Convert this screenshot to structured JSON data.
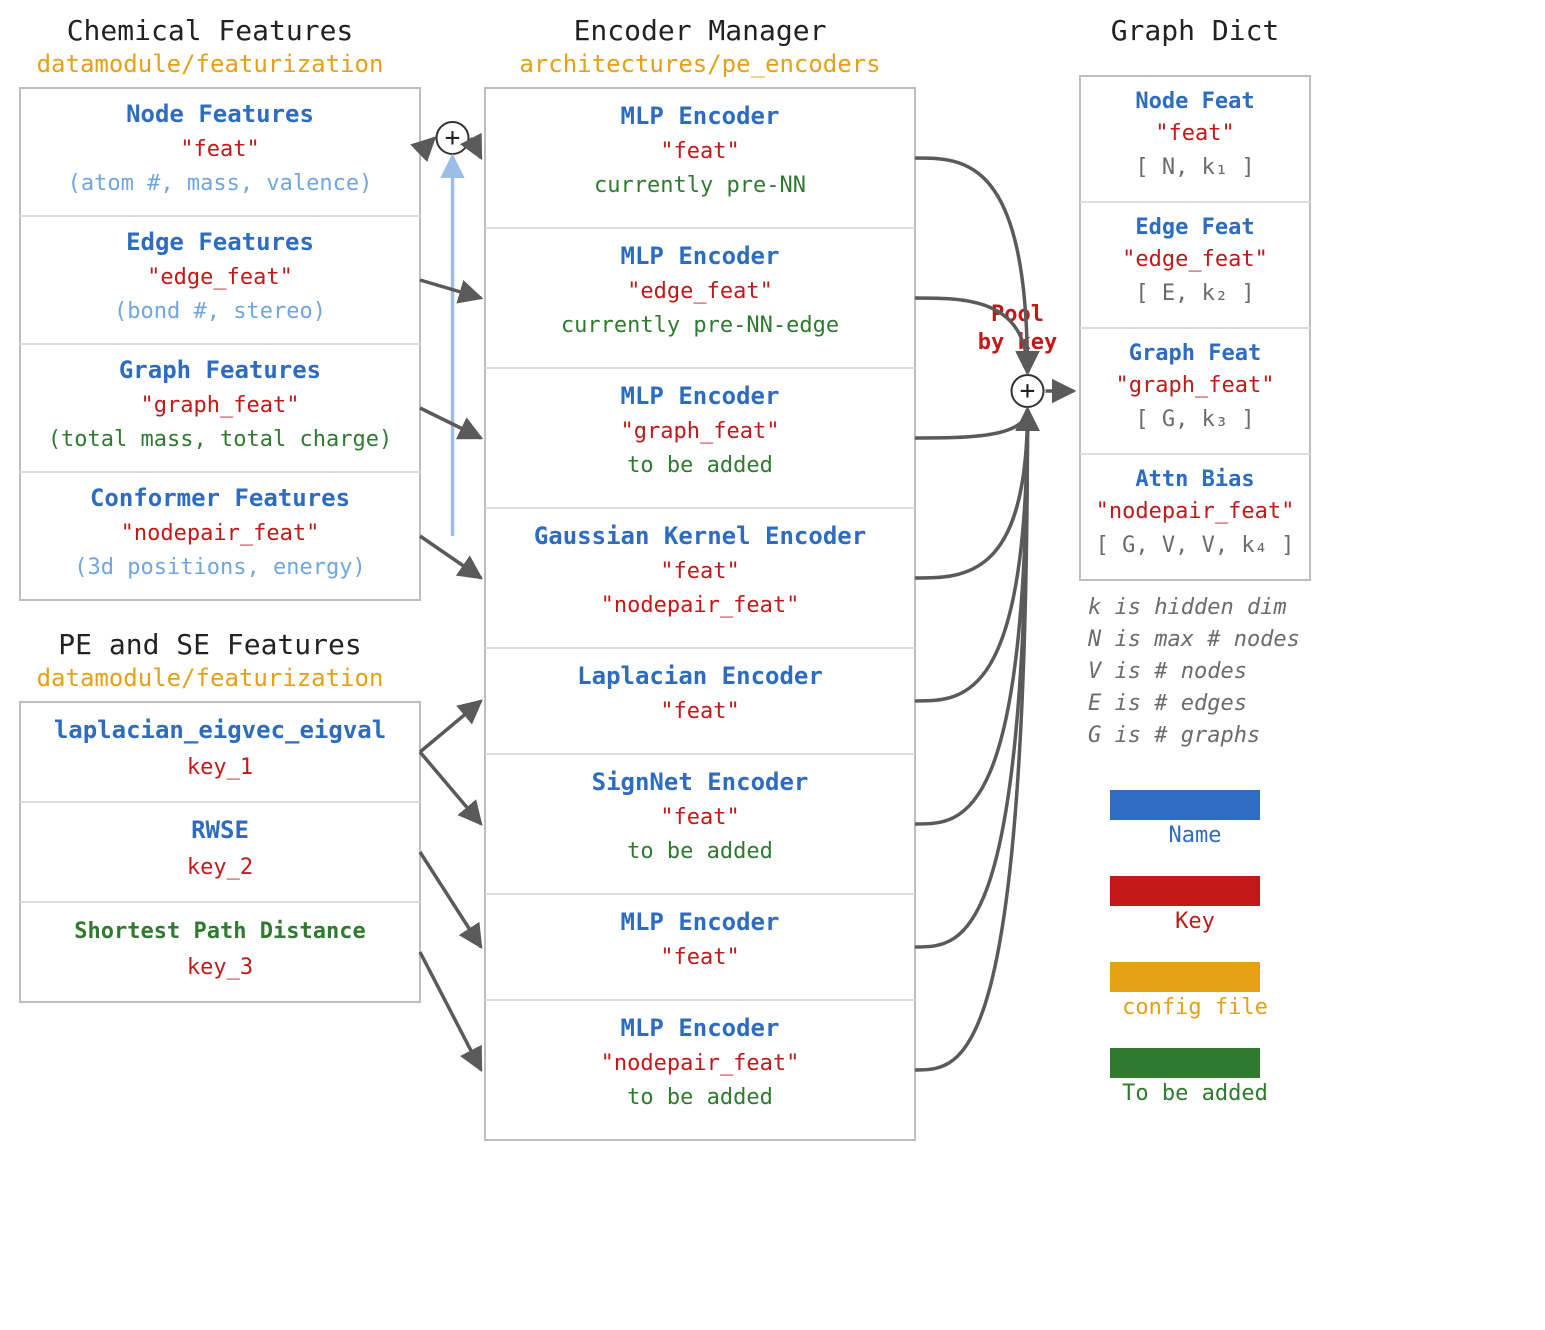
{
  "columns": {
    "left": {
      "chem": {
        "title": "Chemical Features",
        "subtitle": "datamodule/featurization",
        "items": [
          {
            "name": "Node Features",
            "key": "\"feat\"",
            "hint": "(atom #, mass, valence)"
          },
          {
            "name": "Edge Features",
            "key": "\"edge_feat\"",
            "hint": "(bond #, stereo)"
          },
          {
            "name": "Graph Features",
            "key": "\"graph_feat\"",
            "note": "(total mass, total charge)"
          },
          {
            "name": "Conformer Features",
            "key": "\"nodepair_feat\"",
            "hint": "(3d positions, energy)"
          }
        ]
      },
      "pese": {
        "title": "PE and SE Features",
        "subtitle": "datamodule/featurization",
        "items": [
          {
            "name": "laplacian_eigvec_eigval",
            "key": "key_1"
          },
          {
            "name": "RWSE",
            "key": "key_2"
          },
          {
            "nameGreen": "Shortest Path Distance",
            "key": "key_3"
          }
        ]
      }
    },
    "mid": {
      "title": "Encoder Manager",
      "subtitle": "architectures/pe_encoders",
      "items": [
        {
          "name": "MLP Encoder",
          "key": "\"feat\"",
          "note": "currently pre-NN"
        },
        {
          "name": "MLP Encoder",
          "key": "\"edge_feat\"",
          "note": "currently pre-NN-edge"
        },
        {
          "name": "MLP Encoder",
          "key": "\"graph_feat\"",
          "note": "to be added"
        },
        {
          "name": "Gaussian Kernel Encoder",
          "key": "\"feat\"",
          "key2": "\"nodepair_feat\""
        },
        {
          "name": "Laplacian Encoder",
          "key": "\"feat\""
        },
        {
          "name": "SignNet Encoder",
          "key": "\"feat\"",
          "note": "to be added"
        },
        {
          "name": "MLP Encoder",
          "key": "\"feat\""
        },
        {
          "name": "MLP Encoder",
          "key": "\"nodepair_feat\"",
          "note": "to be added"
        }
      ]
    },
    "right": {
      "title": "Graph Dict",
      "pool_label": "Pool\nby key",
      "items": [
        {
          "name": "Node Feat",
          "key": "\"feat\"",
          "dim": "[ N, k₁ ]"
        },
        {
          "name": "Edge Feat",
          "key": "\"edge_feat\"",
          "dim": "[ E, k₂ ]"
        },
        {
          "name": "Graph Feat",
          "key": "\"graph_feat\"",
          "dim": "[ G, k₃ ]"
        },
        {
          "name": "Attn Bias",
          "key": "\"nodepair_feat\"",
          "dim": "[ G, V, V, k₄ ]"
        }
      ],
      "legend_notes": [
        "k is hidden dim",
        "N is max # nodes",
        "V is # nodes",
        "E is # edges",
        "G is # graphs"
      ],
      "legend_swatches": [
        {
          "color": "#2d6cc0",
          "label": "Name",
          "labelColor": "#2d6cc0"
        },
        {
          "color": "#c31818",
          "label": "Key",
          "labelColor": "#c31818"
        },
        {
          "color": "#e6a016",
          "label": "config file",
          "labelColor": "#e6a016"
        },
        {
          "color": "#2f7a2f",
          "label": "To be added",
          "labelColor": "#2f7a2f"
        }
      ]
    }
  }
}
